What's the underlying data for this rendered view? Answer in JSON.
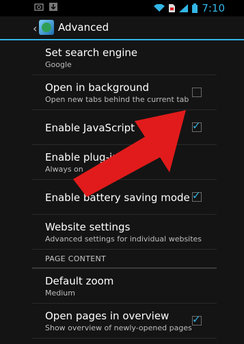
{
  "status": {
    "time": "7:10",
    "accent": "#33b5e5"
  },
  "actionbar": {
    "title": "Advanced"
  },
  "prefs": [
    {
      "label": "Set search engine",
      "sub": "Google"
    },
    {
      "label": "Open in background",
      "sub": "Open new tabs behind the current tab",
      "checked": false
    },
    {
      "label": "Enable JavaScript",
      "checked": true
    },
    {
      "label": "Enable plug-ins",
      "sub": "Always on"
    },
    {
      "label": "Enable battery saving mode",
      "checked": true
    },
    {
      "label": "Website settings",
      "sub": "Advanced settings for individual websites"
    },
    {
      "label": "Default zoom",
      "sub": "Medium"
    },
    {
      "label": "Open pages in overview",
      "sub": "Show overview of newly-opened pages",
      "checked": true
    }
  ],
  "section_header": "PAGE CONTENT",
  "annotation_arrow_color": "#e11b1b"
}
